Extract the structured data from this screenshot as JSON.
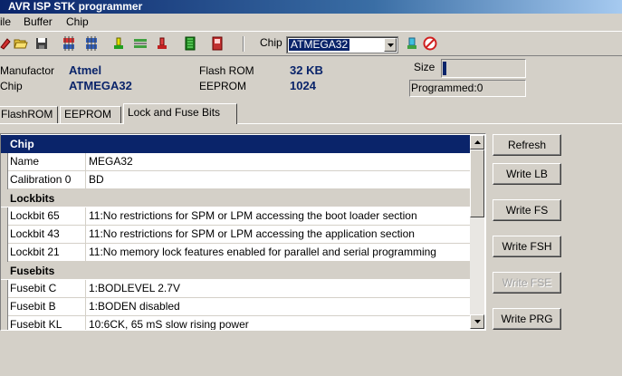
{
  "window": {
    "title": "AVR ISP STK programmer"
  },
  "menu": [
    {
      "label": "ile"
    },
    {
      "label": "Buffer"
    },
    {
      "label": "Chip"
    }
  ],
  "toolbar": {
    "chip_label": "Chip",
    "chip_value": "ATMEGA32"
  },
  "info": {
    "manufactor_label": "Manufactor",
    "manufactor_value": "Atmel",
    "chip_label": "Chip",
    "chip_value": "ATMEGA32",
    "flash_label": "Flash ROM",
    "flash_value": "32 KB",
    "eeprom_label": "EEPROM",
    "eeprom_value": "1024",
    "size_label": "Size",
    "size_fraction": 0.04,
    "programmed": "Programmed:0"
  },
  "tabs": [
    {
      "label": "FlashROM",
      "active": false
    },
    {
      "label": "EEPROM",
      "active": false
    },
    {
      "label": "Lock and Fuse Bits",
      "active": true
    }
  ],
  "grid": {
    "chip_header": "Chip",
    "chip_rows": [
      {
        "name": "Name",
        "value": "MEGA32"
      },
      {
        "name": "Calibration 0",
        "value": "BD"
      }
    ],
    "lockbits_header": "Lockbits",
    "lockbit_rows": [
      {
        "name": "Lockbit 65",
        "value": "11:No restrictions for SPM or LPM accessing the boot loader section"
      },
      {
        "name": "Lockbit 43",
        "value": "11:No restrictions for SPM or LPM accessing the application section"
      },
      {
        "name": "Lockbit 21",
        "value": "11:No memory lock features enabled for parallel and serial programming"
      }
    ],
    "fusebits_header": "Fusebits",
    "fusebit_rows": [
      {
        "name": "Fusebit C",
        "value": "1:BODLEVEL 2.7V"
      },
      {
        "name": "Fusebit B",
        "value": "1:BODEN disabled"
      },
      {
        "name": "Fusebit KL",
        "value": "10:6CK, 65 mS slow rising power"
      }
    ]
  },
  "buttons": {
    "refresh": "Refresh",
    "write_lb": "Write LB",
    "write_fs": "Write FS",
    "write_fsh": "Write FSH",
    "write_fse": "Write FSE",
    "write_prg": "Write PRG"
  }
}
